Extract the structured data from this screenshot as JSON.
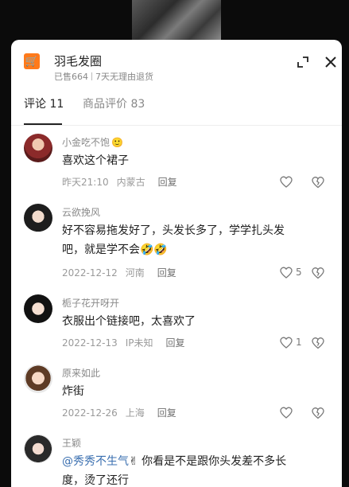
{
  "product": {
    "title": "羽毛发圈",
    "sold": "已售664",
    "returns": "7天无理由退货"
  },
  "tabs": {
    "comments": "评论 11",
    "reviews": "商品评价 83"
  },
  "comments": [
    {
      "user": "小金吃不饱",
      "user_emoji": "🙂",
      "text": "喜欢这个裙子",
      "time": "昨天21:10",
      "location": "内蒙古",
      "reply": "回复",
      "likes": ""
    },
    {
      "user": "云欲挽风",
      "text_line1": "好不容易拖发好了，头发长多了，学学扎头发",
      "text_line2": "吧，就是学不会",
      "emojis": "🤣🤣",
      "time": "2022-12-12",
      "location": "河南",
      "reply": "回复",
      "likes": "5"
    },
    {
      "user": "栀子花开呀开",
      "text": "衣服出个链接吧，太喜欢了",
      "time": "2022-12-13",
      "location": "IP未知",
      "reply": "回复",
      "likes": "1"
    },
    {
      "user": "原来如此",
      "text": "炸街",
      "time": "2022-12-26",
      "location": "上海",
      "reply": "回复",
      "likes": ""
    },
    {
      "user": "王颖",
      "mention": "@秀秀不生气",
      "mention_emoji": "✌",
      "text_line1": " 你看是不是跟你头发差不多长",
      "text_line2": "度，烫了还行"
    }
  ],
  "icons": [
    "cart-icon",
    "expand-icon",
    "close-icon",
    "heart-icon",
    "broken-heart-icon"
  ],
  "colors": {
    "accent": "#ff7a1a",
    "mention": "#3a6fb0"
  }
}
